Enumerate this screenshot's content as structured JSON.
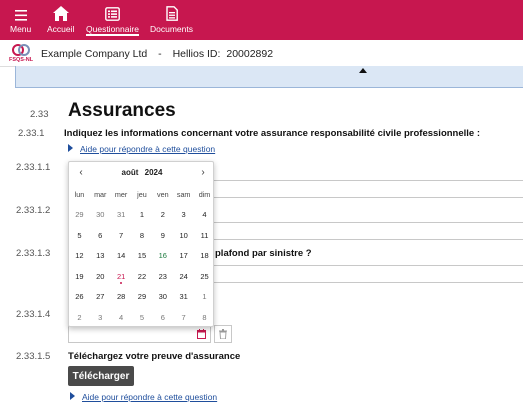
{
  "nav": {
    "items": [
      {
        "label": "Menu",
        "icon": "hamburger-icon"
      },
      {
        "label": "Accueil",
        "icon": "home-icon"
      },
      {
        "label": "Questionnaire",
        "icon": "questionnaire-icon",
        "active": true
      },
      {
        "label": "Documents",
        "icon": "document-icon"
      }
    ]
  },
  "colors": {
    "brand": "#c7174f",
    "link": "#1f4e9c",
    "strip": "#dbe7f5"
  },
  "company": {
    "logo_text": "FSQS-NL",
    "name": "Example Company Ltd",
    "separator": "-",
    "id_label": "Hellios ID:",
    "id_value": "20002892"
  },
  "section": {
    "number": "2.33",
    "title": "Assurances"
  },
  "questions": [
    {
      "number": "2.33.1",
      "text": "Indiquez les informations concernant votre assurance responsabilité civile professionnelle :"
    },
    {
      "number": "2.33.1.1"
    },
    {
      "number": "2.33.1.2"
    },
    {
      "number": "2.33.1.3",
      "text_partial": "plafond par sinistre ?"
    },
    {
      "number": "2.33.1.4"
    },
    {
      "number": "2.33.1.5",
      "text": "Téléchargez votre preuve d'assurance"
    }
  ],
  "help_link": "Aide pour répondre à cette question",
  "upload_label": "Télécharger",
  "calendar": {
    "prev": "‹",
    "next": "›",
    "month": "août",
    "year": "2024",
    "weekdays": [
      "lun",
      "mar",
      "mer",
      "jeu",
      "ven",
      "sam",
      "dim"
    ],
    "weeks": [
      [
        "29",
        "30",
        "31",
        "1",
        "2",
        "3",
        "4"
      ],
      [
        "5",
        "6",
        "7",
        "8",
        "9",
        "10",
        "11"
      ],
      [
        "12",
        "13",
        "14",
        "15",
        "16",
        "17",
        "18"
      ],
      [
        "19",
        "20",
        "21",
        "22",
        "23",
        "24",
        "25"
      ],
      [
        "26",
        "27",
        "28",
        "29",
        "30",
        "31",
        "1"
      ],
      [
        "2",
        "3",
        "4",
        "5",
        "6",
        "7",
        "8"
      ]
    ],
    "today": "21",
    "highlight": "16"
  }
}
